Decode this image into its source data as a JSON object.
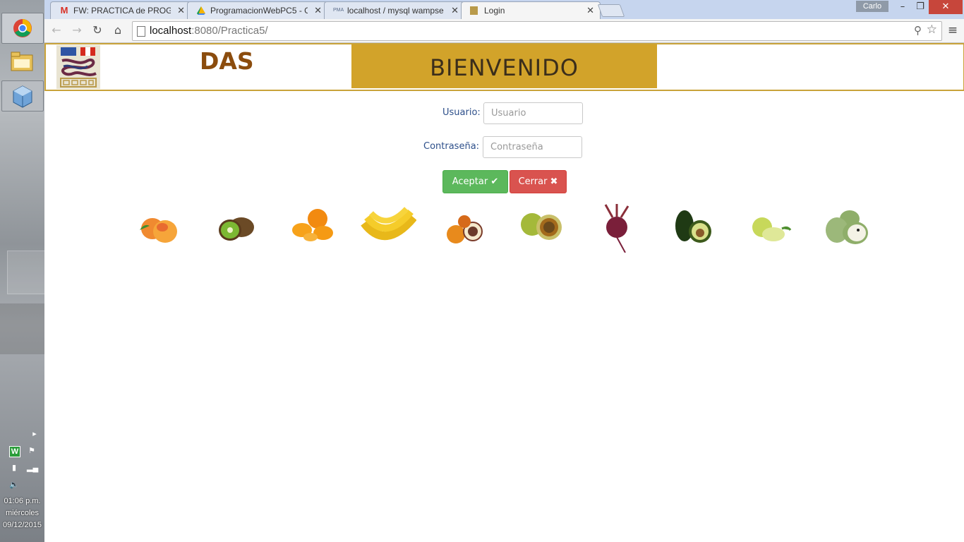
{
  "os": {
    "clock": {
      "time": "01:06 p.m.",
      "day": "miércoles",
      "date": "09/12/2015"
    }
  },
  "browser": {
    "tabs": [
      {
        "label": "FW: PRACTICA de PROGRA",
        "favicon": "gmail-icon"
      },
      {
        "label": "ProgramacionWebPC5 - G",
        "favicon": "drive-icon"
      },
      {
        "label": "localhost / mysql wampse",
        "favicon": "phpmyadmin-icon"
      },
      {
        "label": "Login",
        "favicon": "page-icon"
      }
    ],
    "profile": "Carlo",
    "url_host": "localhost",
    "url_rest": ":8080/Practica5/"
  },
  "page": {
    "site_name": "DAS",
    "banner_title": "BIENVENIDO",
    "form": {
      "user_label": "Usuario:",
      "user_placeholder": "Usuario",
      "password_label": "Contraseña:",
      "password_placeholder": "Contraseña",
      "accept_label": "Aceptar ✔",
      "close_label": "Cerrar ✖"
    },
    "fruits": [
      "peach-image",
      "kiwi-image",
      "orange-image",
      "banana-image",
      "passionfruit-image",
      "granadilla-image",
      "beet-image",
      "avocado-image",
      "pear-image",
      "cherimoya-image"
    ]
  }
}
